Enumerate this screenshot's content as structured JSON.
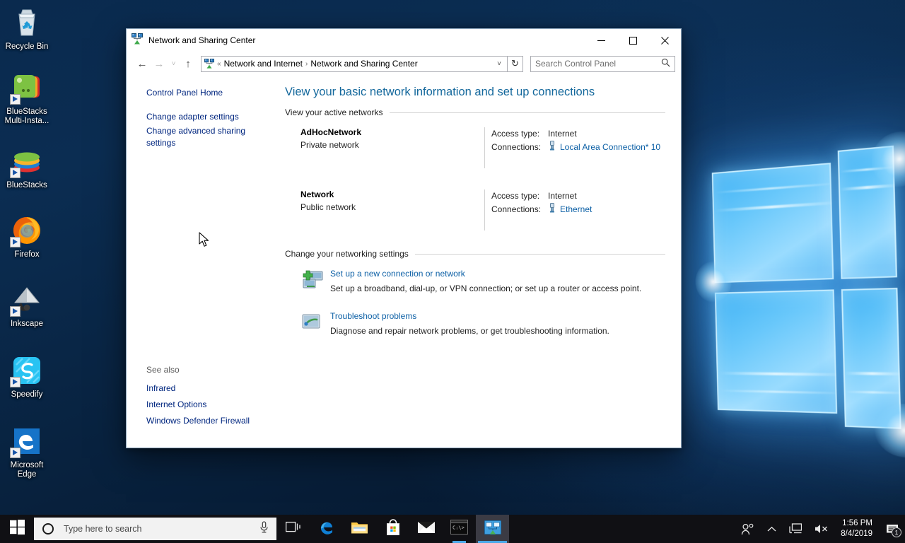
{
  "desktop": {
    "icons": [
      {
        "label": "Recycle Bin",
        "icon": "recycle-bin-icon",
        "shortcut": false
      },
      {
        "label": "BlueStacks Multi-Insta...",
        "icon": "bluestacks-multi-instance-icon",
        "shortcut": true
      },
      {
        "label": "BlueStacks",
        "icon": "bluestacks-icon",
        "shortcut": true
      },
      {
        "label": "Firefox",
        "icon": "firefox-icon",
        "shortcut": true
      },
      {
        "label": "Inkscape",
        "icon": "inkscape-icon",
        "shortcut": true
      },
      {
        "label": "Speedify",
        "icon": "speedify-icon",
        "shortcut": true
      },
      {
        "label": "Microsoft Edge",
        "icon": "microsoft-edge-icon",
        "shortcut": true
      }
    ]
  },
  "window": {
    "title": "Network and Sharing Center",
    "title_icon": "network-sharing-center-icon",
    "controls": {
      "minimize": "–",
      "maximize": "☐",
      "close": "✕"
    },
    "nav": {
      "back": "←",
      "forward": "→",
      "recent": "˅",
      "up": "↑",
      "breadcrumb_icon": "network-sharing-center-icon",
      "breadcrumb_prefix": "«",
      "crumbs": [
        "Network and Internet",
        "Network and Sharing Center"
      ],
      "separator": "›",
      "dropdown": "˅",
      "refresh": "↻",
      "refresh_name": "refresh-icon"
    },
    "search": {
      "placeholder": "Search Control Panel",
      "icon": "search-icon"
    }
  },
  "sidebar": {
    "primary": [
      {
        "label": "Control Panel Home"
      },
      {
        "label": "Change adapter settings"
      },
      {
        "label": "Change advanced sharing settings"
      }
    ],
    "see_also_header": "See also",
    "see_also": [
      {
        "label": "Infrared"
      },
      {
        "label": "Internet Options"
      },
      {
        "label": "Windows Defender Firewall"
      }
    ]
  },
  "content": {
    "heading": "View your basic network information and set up connections",
    "active_networks_header": "View your active networks",
    "networks": [
      {
        "name": "AdHocNetwork",
        "type": "Private network",
        "access_label": "Access type:",
        "access_value": "Internet",
        "connections_label": "Connections:",
        "connection_name": "Local Area Connection* 10",
        "connection_icon": "ethernet-adapter-icon"
      },
      {
        "name": "Network",
        "type": "Public network",
        "access_label": "Access type:",
        "access_value": "Internet",
        "connections_label": "Connections:",
        "connection_name": "Ethernet",
        "connection_icon": "ethernet-adapter-icon"
      }
    ],
    "settings_header": "Change your networking settings",
    "tasks": [
      {
        "link": "Set up a new connection or network",
        "desc": "Set up a broadband, dial-up, or VPN connection; or set up a router or access point.",
        "icon": "new-connection-icon"
      },
      {
        "link": "Troubleshoot problems",
        "desc": "Diagnose and repair network problems, or get troubleshooting information.",
        "icon": "troubleshoot-icon"
      }
    ]
  },
  "taskbar": {
    "start_icon": "windows-start-icon",
    "search": {
      "placeholder": "Type here to search",
      "icon": "search-circle-icon",
      "mic": "microphone-icon"
    },
    "buttons": [
      {
        "name": "task-view",
        "icon": "task-view-icon",
        "state": "idle"
      },
      {
        "name": "edge",
        "icon": "microsoft-edge-icon",
        "state": "idle"
      },
      {
        "name": "file-explorer",
        "icon": "file-explorer-icon",
        "state": "idle"
      },
      {
        "name": "microsoft-store",
        "icon": "microsoft-store-icon",
        "state": "idle"
      },
      {
        "name": "mail",
        "icon": "mail-icon",
        "state": "idle"
      },
      {
        "name": "command-prompt",
        "icon": "command-prompt-icon",
        "state": "running"
      },
      {
        "name": "network-sharing-center",
        "icon": "network-sharing-center-icon",
        "state": "active"
      }
    ],
    "tray": [
      {
        "name": "people",
        "icon": "people-icon"
      },
      {
        "name": "show-hidden-icons",
        "icon": "chevron-up-icon"
      },
      {
        "name": "network",
        "icon": "network-monitor-icon"
      },
      {
        "name": "volume",
        "icon": "volume-muted-icon"
      }
    ],
    "clock": {
      "time": "1:56 PM",
      "date": "8/4/2019"
    },
    "notifications": {
      "icon": "notification-icon",
      "count": "1"
    }
  },
  "colors": {
    "accent": "#0078d7",
    "link": "#0b5fa5",
    "heading": "#14689c",
    "sidebar_link": "#00267f",
    "taskbar": "#101014"
  }
}
